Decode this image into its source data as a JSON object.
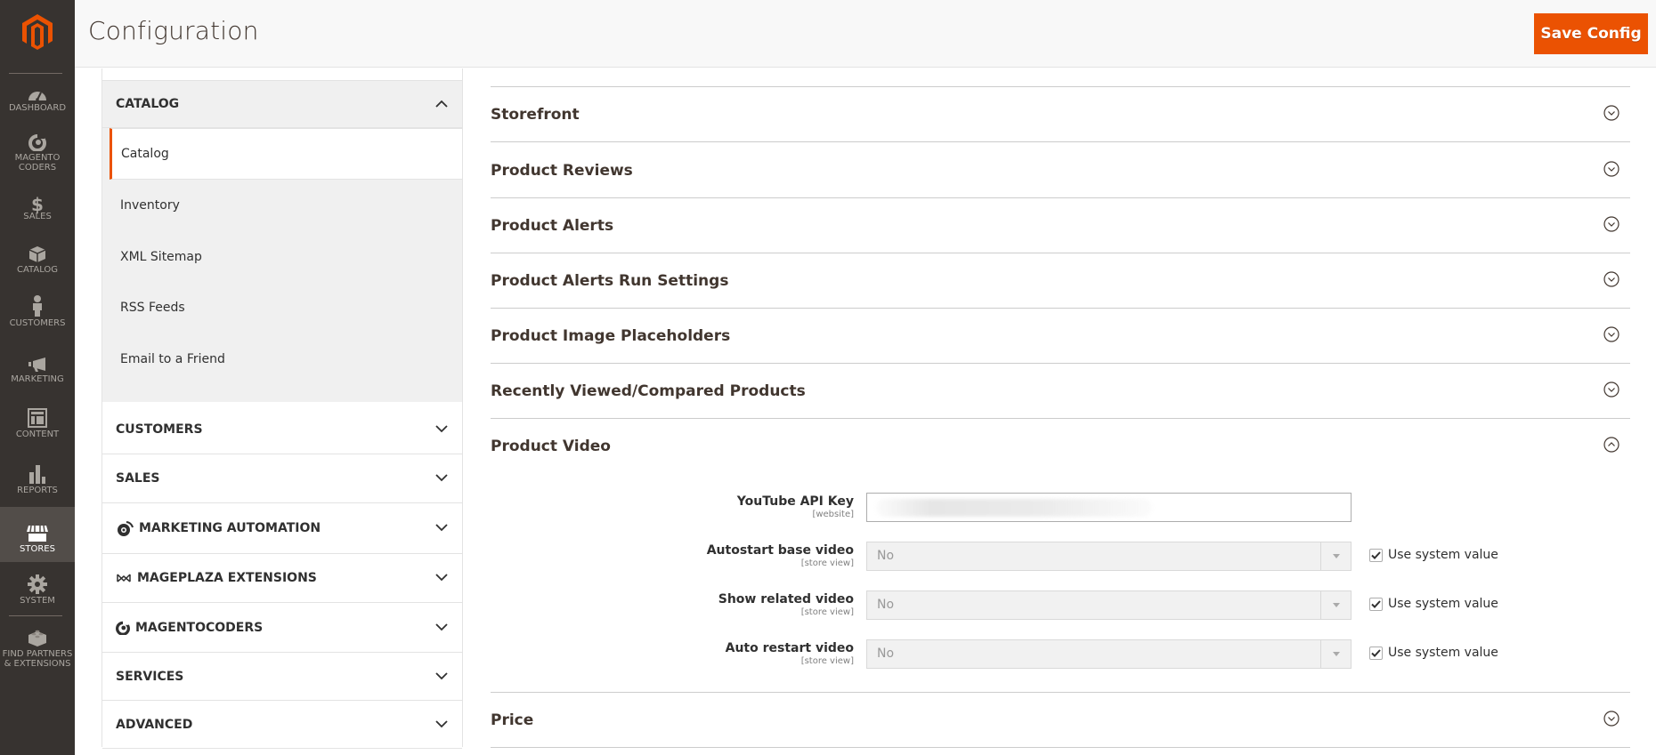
{
  "colors": {
    "accent": "#eb5202",
    "nav_bg": "#373330",
    "nav_active_bg": "#524d49",
    "header_bg": "#f8f8f8"
  },
  "admin_nav": {
    "logo_icon": "magento-logo-icon",
    "items": [
      {
        "label": "DASHBOARD",
        "icon": "dashboard-gauge-icon",
        "active": false
      },
      {
        "label": "MAGENTO CODERS",
        "icon": "magentocoders-icon",
        "active": false
      },
      {
        "label": "SALES",
        "icon": "dollar-icon",
        "active": false
      },
      {
        "label": "CATALOG",
        "icon": "box-icon",
        "active": false
      },
      {
        "label": "CUSTOMERS",
        "icon": "person-icon",
        "active": false
      },
      {
        "label": "MARKETING",
        "icon": "megaphone-icon",
        "active": false
      },
      {
        "label": "CONTENT",
        "icon": "layout-icon",
        "active": false
      },
      {
        "label": "REPORTS",
        "icon": "bar-chart-icon",
        "active": false
      },
      {
        "label": "STORES",
        "icon": "storefront-icon",
        "active": true
      },
      {
        "label": "SYSTEM",
        "icon": "gear-icon",
        "active": false
      },
      {
        "label": "FIND PARTNERS & EXTENSIONS",
        "icon": "lego-brick-icon",
        "active": false
      }
    ]
  },
  "header": {
    "title": "Configuration",
    "save_label": "Save Config"
  },
  "config_tabs": {
    "catalog_group": {
      "label": "CATALOG",
      "expanded": true,
      "items": [
        {
          "label": "Catalog",
          "active": true
        },
        {
          "label": "Inventory",
          "active": false
        },
        {
          "label": "XML Sitemap",
          "active": false
        },
        {
          "label": "RSS Feeds",
          "active": false
        },
        {
          "label": "Email to a Friend",
          "active": false
        }
      ]
    },
    "other_groups": [
      {
        "label": "CUSTOMERS",
        "icon": ""
      },
      {
        "label": "SALES",
        "icon": ""
      },
      {
        "label": "MARKETING AUTOMATION",
        "icon": "dotdigital-icon"
      },
      {
        "label": "MAGEPLAZA EXTENSIONS",
        "icon": "mageplaza-icon"
      },
      {
        "label": "MAGENTOCODERS",
        "icon": "magentocoders-icon"
      },
      {
        "label": "SERVICES",
        "icon": ""
      },
      {
        "label": "ADVANCED",
        "icon": ""
      }
    ]
  },
  "sections": [
    {
      "title": "Storefront",
      "expanded": false
    },
    {
      "title": "Product Reviews",
      "expanded": false
    },
    {
      "title": "Product Alerts",
      "expanded": false
    },
    {
      "title": "Product Alerts Run Settings",
      "expanded": false
    },
    {
      "title": "Product Image Placeholders",
      "expanded": false
    },
    {
      "title": "Recently Viewed/Compared Products",
      "expanded": false
    },
    {
      "title": "Product Video",
      "expanded": true
    },
    {
      "title": "Price",
      "expanded": false
    }
  ],
  "product_video": {
    "fields": [
      {
        "label": "YouTube API Key",
        "scope": "[website]",
        "type": "text",
        "value": "(blurred)"
      },
      {
        "label": "Autostart base video",
        "scope": "[store view]",
        "type": "select",
        "value": "No",
        "use_system_value": true,
        "use_system_label": "Use system value"
      },
      {
        "label": "Show related video",
        "scope": "[store view]",
        "type": "select",
        "value": "No",
        "use_system_value": true,
        "use_system_label": "Use system value"
      },
      {
        "label": "Auto restart video",
        "scope": "[store view]",
        "type": "select",
        "value": "No",
        "use_system_value": true,
        "use_system_label": "Use system value"
      }
    ]
  }
}
